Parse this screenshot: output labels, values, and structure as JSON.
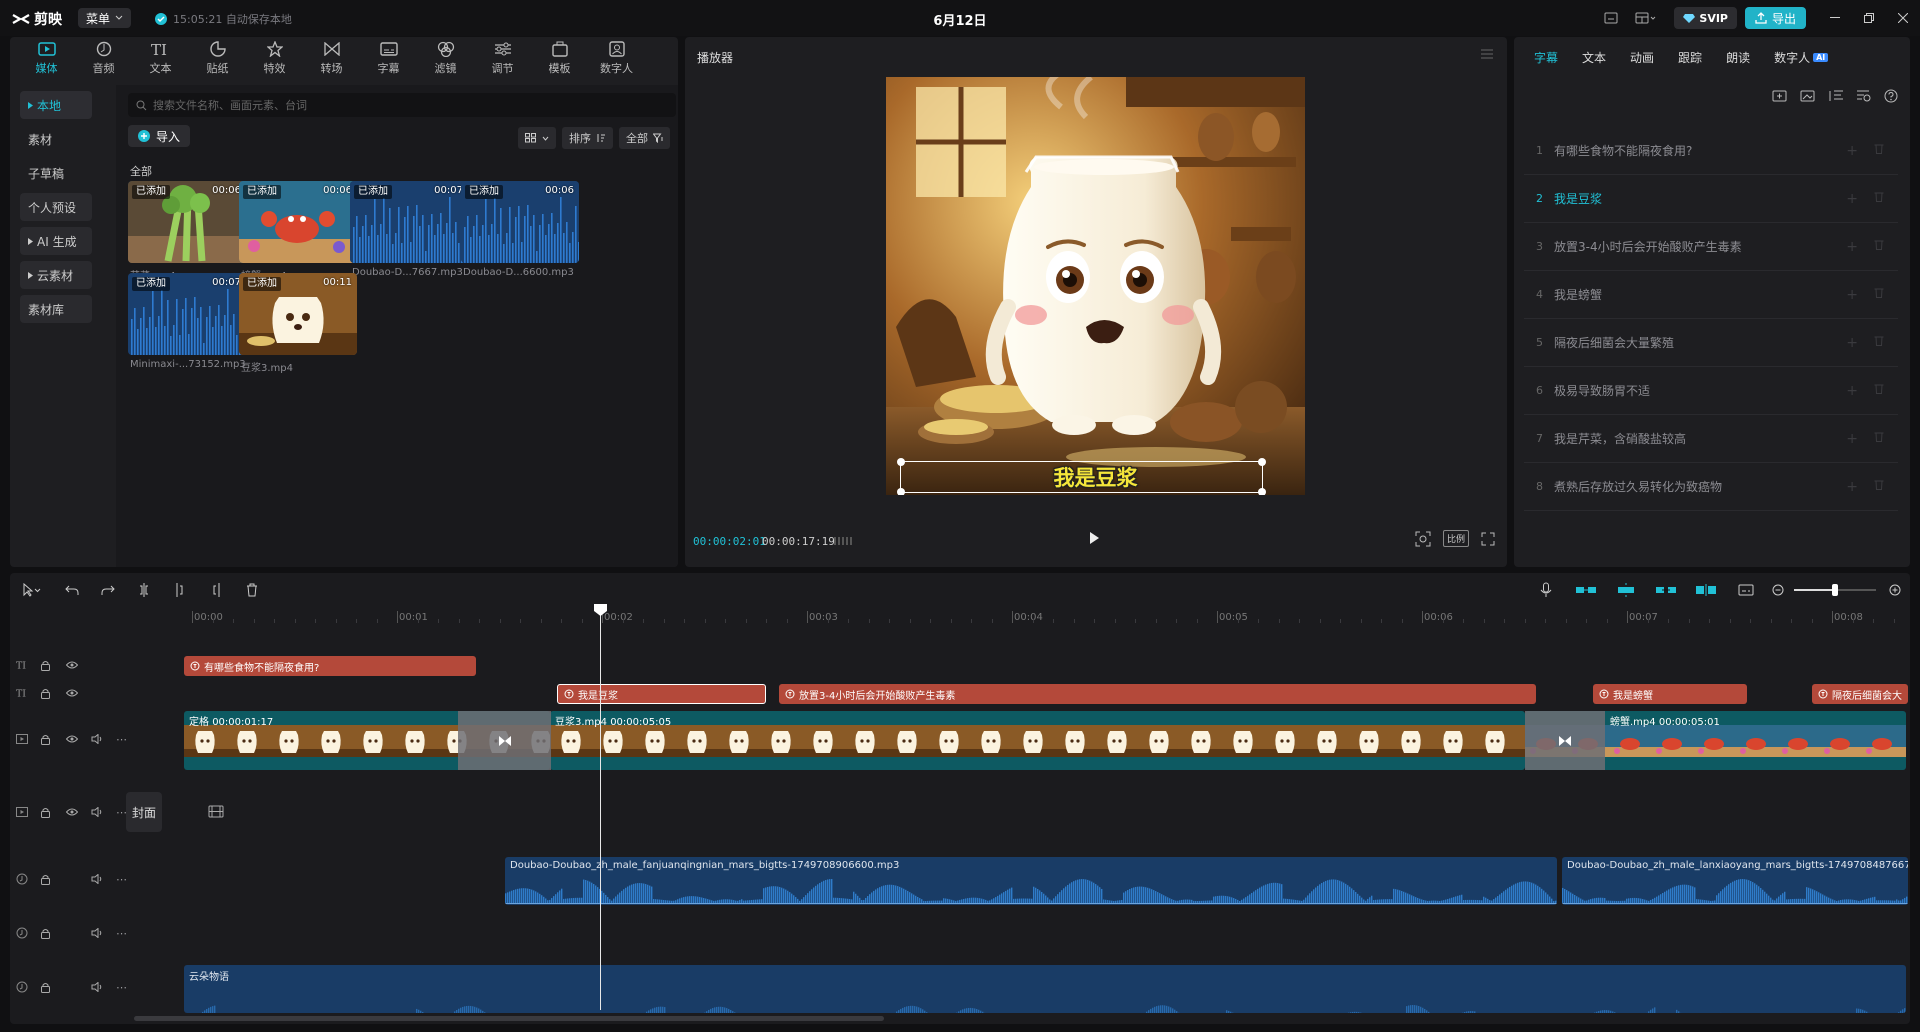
{
  "titlebar": {
    "app_name": "剪映",
    "menu_label": "菜单",
    "autosave": "15:05:21 自动保存本地",
    "project_title": "6月12日",
    "svip_label": "SVIP",
    "export_label": "导出"
  },
  "tool_tabs": [
    {
      "label": "媒体",
      "icon": "media-icon"
    },
    {
      "label": "音频",
      "icon": "audio-icon"
    },
    {
      "label": "文本",
      "icon": "text-icon"
    },
    {
      "label": "贴纸",
      "icon": "sticker-icon"
    },
    {
      "label": "特效",
      "icon": "effects-icon"
    },
    {
      "label": "转场",
      "icon": "transition-icon"
    },
    {
      "label": "字幕",
      "icon": "subtitle-icon"
    },
    {
      "label": "滤镜",
      "icon": "filter-icon"
    },
    {
      "label": "调节",
      "icon": "adjust-icon"
    },
    {
      "label": "模板",
      "icon": "template-icon"
    },
    {
      "label": "数字人",
      "icon": "digital-human-icon"
    }
  ],
  "media_nav": [
    {
      "label": "本地",
      "active": true,
      "arrow": true
    },
    {
      "label": "素材"
    },
    {
      "label": "子草稿"
    },
    {
      "label": "个人预设",
      "filled": true
    },
    {
      "label": "AI 生成",
      "filled": true,
      "arrow": true
    },
    {
      "label": "云素材",
      "filled": true,
      "arrow": true
    },
    {
      "label": "素材库",
      "filled": true
    }
  ],
  "media": {
    "search_placeholder": "搜索文件名称、画面元素、台词",
    "import_label": "导入",
    "sort_label": "排序",
    "filter_label": "全部",
    "section_label": "全部",
    "added_badge": "已添加",
    "items": [
      {
        "name": "芹菜.mp4",
        "duration": "00:06",
        "kind": "celery"
      },
      {
        "name": "螃蟹.mp4",
        "duration": "00:06",
        "kind": "crab"
      },
      {
        "name": "Doubao-D...7667.mp3",
        "duration": "00:07",
        "kind": "audio"
      },
      {
        "name": "Doubao-D...6600.mp3",
        "duration": "00:06",
        "kind": "audio"
      },
      {
        "name": "Minimaxi-...73152.mp3",
        "duration": "00:07",
        "kind": "audio"
      },
      {
        "name": "豆浆3.mp4",
        "duration": "00:11",
        "kind": "milk"
      }
    ]
  },
  "player": {
    "title": "播放器",
    "caption": "我是豆浆",
    "current_time": "00:00:02:01",
    "total_time": "00:00:17:19",
    "ratio_label": "比例"
  },
  "subtitle_panel": {
    "tabs": [
      "字幕",
      "文本",
      "动画",
      "跟踪",
      "朗读",
      "数字人"
    ],
    "ai_badge": "AI",
    "rows": [
      {
        "num": "1",
        "text": "有哪些食物不能隔夜食用?"
      },
      {
        "num": "2",
        "text": "我是豆浆",
        "active": true
      },
      {
        "num": "3",
        "text": "放置3-4小时后会开始酸败产生毒素"
      },
      {
        "num": "4",
        "text": "我是螃蟹"
      },
      {
        "num": "5",
        "text": "隔夜后细菌会大量繁殖"
      },
      {
        "num": "6",
        "text": "极易导致肠胃不适"
      },
      {
        "num": "7",
        "text": "我是芹菜，含硝酸盐较高"
      },
      {
        "num": "8",
        "text": "煮熟后存放过久易转化为致癌物"
      }
    ]
  },
  "timeline": {
    "ruler": [
      "00:00",
      "00:01",
      "00:02",
      "00:03",
      "00:04",
      "00:05",
      "00:06",
      "00:07",
      "00:08"
    ],
    "cover_label": "封面",
    "text_clips": [
      {
        "text": "有哪些食物不能隔夜食用?"
      },
      {
        "text": "我是豆浆",
        "selected": true
      },
      {
        "text": "放置3-4小时后会开始酸败产生毒素"
      },
      {
        "text": "我是螃蟹"
      },
      {
        "text": "隔夜后细菌会大"
      }
    ],
    "video_clips": [
      {
        "label": "定格",
        "duration": "00:00:01:17"
      },
      {
        "label": "豆浆3.mp4",
        "duration": "00:00:05:05"
      },
      {
        "label": "螃蟹.mp4",
        "duration": "00:00:05:01"
      }
    ],
    "audio_clips": [
      {
        "label": "Doubao-Doubao_zh_male_fanjuanqingnian_mars_bigtts-1749708906600.mp3"
      },
      {
        "label": "Doubao-Doubao_zh_male_lanxiaoyang_mars_bigtts-1749708487667.mp3"
      },
      {
        "label": "云朵物语"
      }
    ]
  },
  "colors": {
    "accent": "#21c1d6",
    "text_clip": "#b4493a",
    "video_clip": "#0d5a62",
    "audio_clip": "#193c66"
  }
}
